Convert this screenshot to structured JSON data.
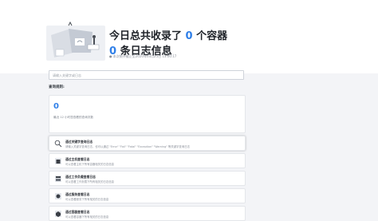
{
  "header": {
    "headline_prefix": "今日总共收录了",
    "container_count": "0",
    "headline_suffix": "个容器",
    "log_count": "0",
    "log_suffix": "条日志信息",
    "meta_text": "● 本次统计截止至2020年03月25日 13:00:17"
  },
  "search": {
    "placeholder": "请输入关键字或日志"
  },
  "query_rules_label": "查询规则:",
  "stats": {
    "value": "0",
    "description": "最近 12 小时您查看的查询次数"
  },
  "rules": [
    {
      "icon": "search-icon",
      "title": "通过关键字查询日志",
      "description": "请输入关键字查询日志，也可以通过 \"Error\" \"Fail\" \"Fatal\" \"Exception\" \"Warning\" 等关键字查询日志"
    },
    {
      "icon": "server-icon",
      "title": "通过主机查看日志",
      "description": "可以查看主机下所有容器相关的日志信息"
    },
    {
      "icon": "workload-icon",
      "title": "通过工作负载查看日志",
      "description": "可以查看工作负载下所有相关的日志信息"
    },
    {
      "icon": "service-icon",
      "title": "通过服务查看日志",
      "description": "可以查看服务下所有相关的日志信息"
    },
    {
      "icon": "container-icon",
      "title": "通过容器查看日志",
      "description": "可以查看容器下所有相关的日志信息"
    }
  ]
}
